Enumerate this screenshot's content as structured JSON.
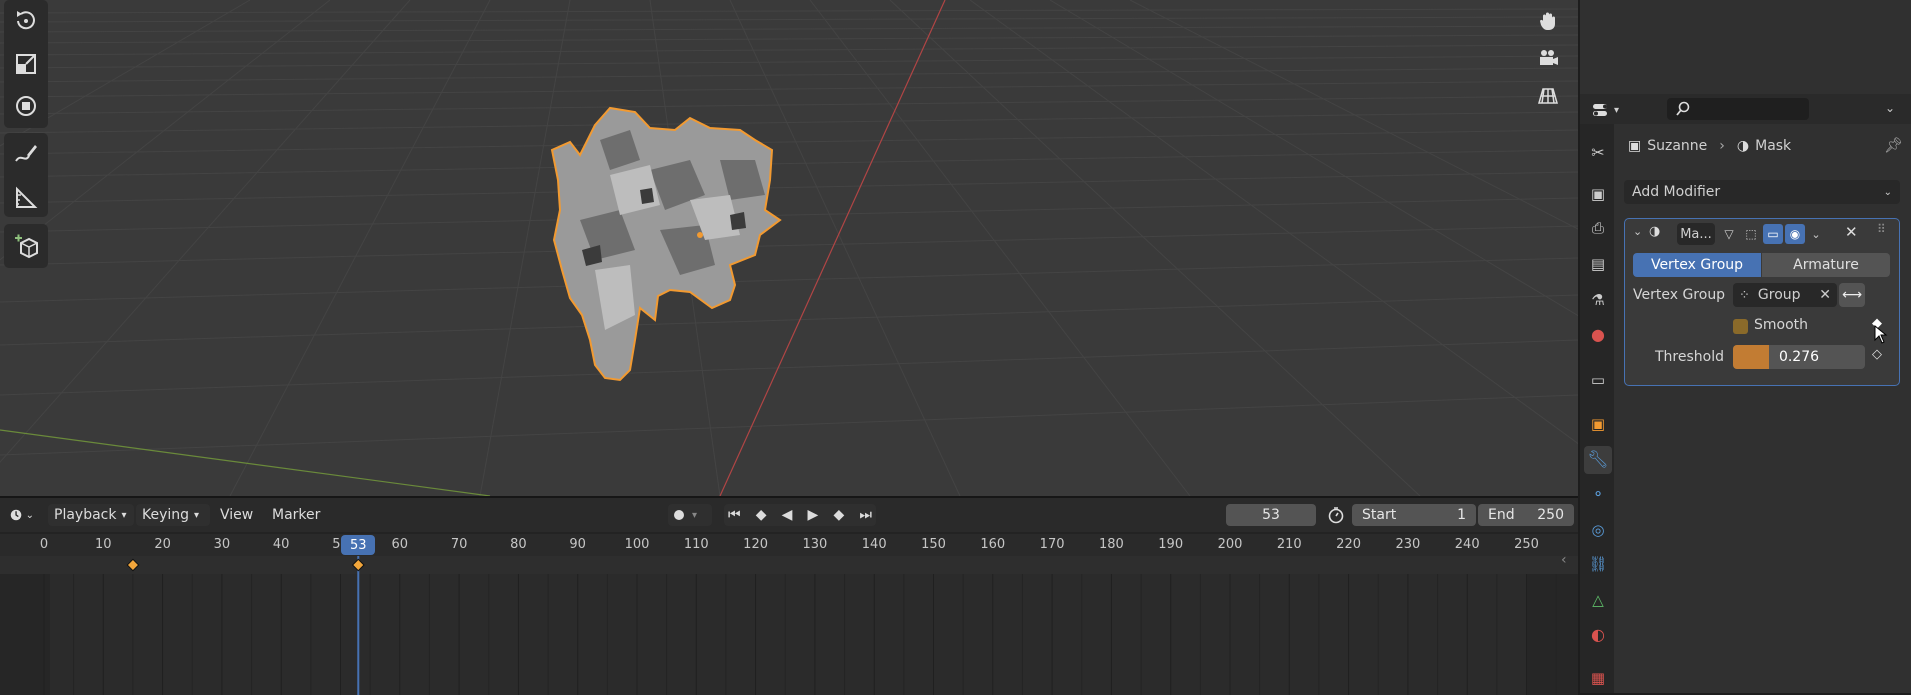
{
  "viewport": {
    "tools_left": [
      "rotate-icon",
      "scale-icon",
      "transform-icon",
      "annotate-icon",
      "measure-icon",
      "add-cube-icon"
    ],
    "nav_right": [
      "hand-pan-icon",
      "camera-icon",
      "grid-toggle-icon"
    ]
  },
  "timeline": {
    "menus": {
      "playback": "Playback",
      "keying": "Keying",
      "view": "View",
      "marker": "Marker"
    },
    "current_frame": "53",
    "start_label": "Start",
    "start_value": "1",
    "end_label": "End",
    "end_value": "250",
    "ruler_ticks": [
      "0",
      "10",
      "20",
      "30",
      "40",
      "50",
      "60",
      "70",
      "80",
      "90",
      "100",
      "110",
      "120",
      "130",
      "140",
      "150",
      "160",
      "170",
      "180",
      "190",
      "200",
      "210",
      "220",
      "230",
      "240",
      "250"
    ],
    "playhead_label": "53"
  },
  "properties": {
    "breadcrumb_object": "Suzanne",
    "breadcrumb_modifier": "Mask",
    "add_modifier": "Add Modifier",
    "modifier_name": "Ma...",
    "mode_vertex_group": "Vertex Group",
    "mode_armature": "Armature",
    "vertex_group_label": "Vertex Group",
    "vertex_group_value": "Group",
    "smooth_label": "Smooth",
    "threshold_label": "Threshold",
    "threshold_value": "0.276",
    "threshold_fraction": 0.276
  },
  "colors": {
    "accent": "#4772b3",
    "selection_outline": "#f29a31",
    "threshold_fill": "#c27c33"
  }
}
